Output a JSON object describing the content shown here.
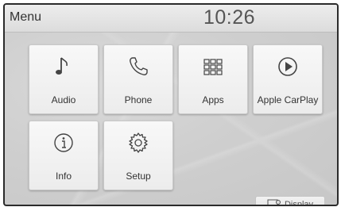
{
  "header": {
    "title": "Menu",
    "clock": "10:26"
  },
  "tiles": [
    {
      "label": "Audio",
      "icon": "music-note-icon"
    },
    {
      "label": "Phone",
      "icon": "phone-icon"
    },
    {
      "label": "Apps",
      "icon": "apps-grid-icon"
    },
    {
      "label": "Apple CarPlay",
      "icon": "carplay-play-icon"
    },
    {
      "label": "Info",
      "icon": "info-icon"
    },
    {
      "label": "Setup",
      "icon": "gear-icon"
    }
  ],
  "display_button": {
    "label": "Display",
    "icon": "display-icon"
  }
}
